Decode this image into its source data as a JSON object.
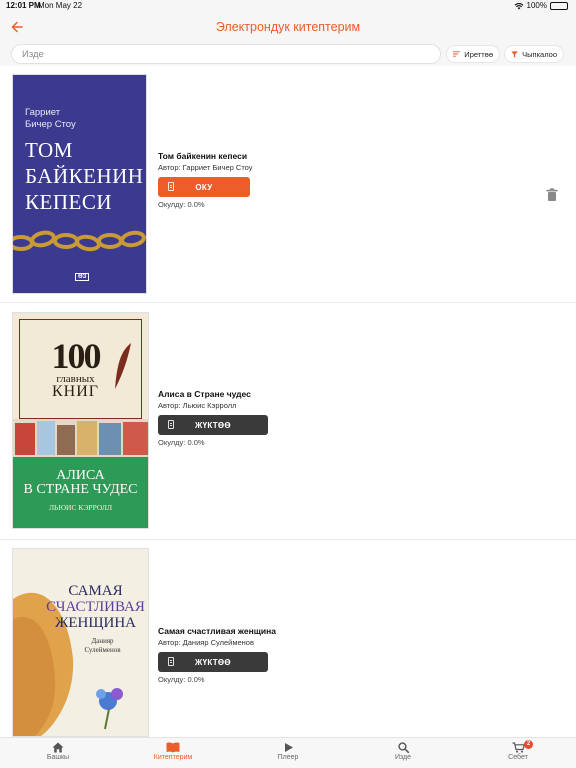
{
  "status": {
    "time": "12:01 PM",
    "date": "Mon May 22",
    "battery": "100%"
  },
  "header": {
    "title": "Электрондук китептерим"
  },
  "toolbar": {
    "search_placeholder": "Изде",
    "sort_label": "Иреттөө",
    "filter_label": "Чыпкалоо"
  },
  "books": [
    {
      "title": "Том байкенин кепеси",
      "author": "Автор: Гарриет Бичер Стоу",
      "action": "ОКУ",
      "progress": "Окулду: 0.0%",
      "cover": {
        "author": "Гарриет Бичер Стоу",
        "title_lines": [
          "ТОМ",
          "БАЙКЕНИН",
          "КЕПЕСИ"
        ],
        "bg": "#3b3a8f",
        "publisher": "ӨЗ"
      }
    },
    {
      "title": "Алиса в Стране чудес",
      "author": "Автор: Льюис Кэрролл",
      "action": "ЖҮКТӨӨ",
      "progress": "Окулду: 0.0%",
      "cover": {
        "series_number": "100",
        "series_line1": "главных",
        "series_line2": "КНИГ",
        "title_lines": [
          "АЛИСА",
          "В СТРАНЕ ЧУДЕС"
        ],
        "author": "ЛЬЮИС КЭРРОЛЛ",
        "bg": "#2e9a57"
      }
    },
    {
      "title": "Самая счастливая женщина",
      "author": "Автор: Данияр Сулейменов",
      "action": "ЖҮКТӨӨ",
      "progress": "Окулду: 0.0%",
      "cover": {
        "title_lines": [
          "САМАЯ",
          "СЧАСТЛИВАЯ",
          "ЖЕНЩИНА"
        ],
        "author_lines": [
          "Данияр",
          "Сулейменов"
        ]
      }
    }
  ],
  "nav": [
    {
      "label": "Башкы",
      "icon": "home-icon"
    },
    {
      "label": "Китептерим",
      "icon": "book-icon",
      "active": true
    },
    {
      "label": "Плеер",
      "icon": "play-icon"
    },
    {
      "label": "Изде",
      "icon": "search-icon"
    },
    {
      "label": "Себет",
      "icon": "cart-icon",
      "badge": "2"
    }
  ],
  "colors": {
    "accent": "#ec5d2a",
    "dark_button": "#3a3a3a",
    "nav_bg": "#f7f7f7"
  }
}
